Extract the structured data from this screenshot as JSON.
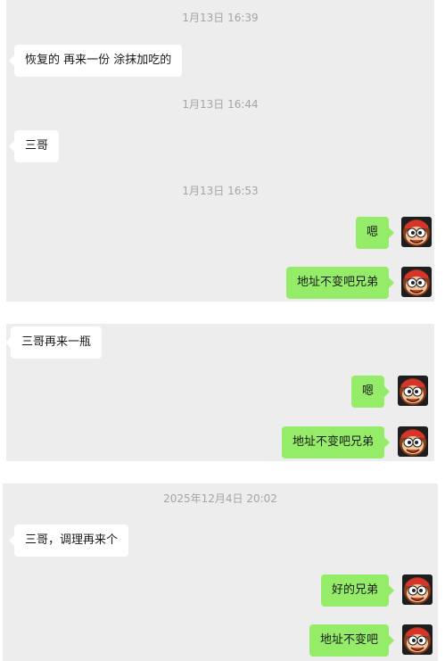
{
  "colors": {
    "panel_bg": "#ededed",
    "received_bubble": "#ffffff",
    "sent_bubble": "#95ec69",
    "timestamp_text": "#a5a5a5"
  },
  "chat1": {
    "timestamps": [
      "1月13日 16:39",
      "1月13日 16:44",
      "1月13日 16:53"
    ],
    "messages": [
      {
        "side": "left",
        "text": "恢复的 再来一份 涂抹加吃的"
      },
      {
        "side": "left",
        "text": "三哥"
      },
      {
        "side": "right",
        "text": "嗯"
      },
      {
        "side": "right",
        "text": "地址不变吧兄弟"
      }
    ]
  },
  "chat2": {
    "messages": [
      {
        "side": "left",
        "text": "三哥再来一瓶"
      },
      {
        "side": "right",
        "text": "嗯"
      },
      {
        "side": "right",
        "text": "地址不变吧兄弟"
      }
    ]
  },
  "chat3": {
    "timestamps": [
      "2025年12月4日 20:02"
    ],
    "messages": [
      {
        "side": "left",
        "text": "三哥，调理再来个"
      },
      {
        "side": "right",
        "text": "好的兄弟"
      },
      {
        "side": "right",
        "text": "地址不变吧"
      }
    ]
  },
  "avatar_icon": "cartoon-monkey-avatar-icon"
}
